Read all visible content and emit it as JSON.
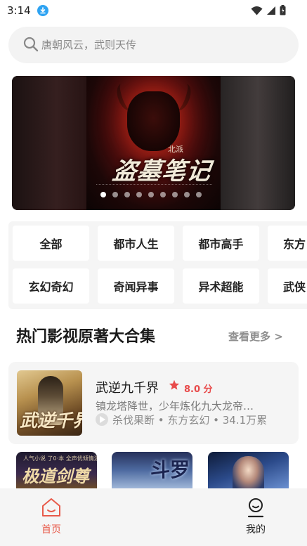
{
  "status_bar": {
    "time": "3:14",
    "icons": [
      "download-icon",
      "wifi-icon",
      "signal-icon",
      "battery-icon"
    ]
  },
  "search": {
    "placeholder": "唐朝风云，武则天传"
  },
  "banner": {
    "title": "盗墓笔记",
    "author_label": "北派",
    "page_count": 9,
    "active_index": 0
  },
  "categories": {
    "row1": [
      "全部",
      "都市人生",
      "都市高手",
      "东方"
    ],
    "row2": [
      "玄幻奇幻",
      "奇闻异事",
      "异术超能",
      "武侠"
    ]
  },
  "section": {
    "title": "热门影视原著大合集",
    "more_label": "查看更多 >"
  },
  "featured": {
    "cover_text": "武逆千界",
    "title": "武逆九千界",
    "score": "8.0 分",
    "description": "镇龙塔降世，少年炼化九大龙帝…",
    "meta": "杀伐果断 • 东方玄幻 • 34.1万累"
  },
  "thumbnails": [
    {
      "title": "极道剑尊",
      "caption": "人气小说 了0·本 全声优倾情演绎"
    },
    {
      "title": "斗罗"
    },
    {
      "title": ""
    }
  ],
  "bottom_nav": {
    "home_label": "首页",
    "mine_label": "我的"
  },
  "colors": {
    "accent": "#e85a4a",
    "star": "#e84a4a",
    "download_badge": "#2ea3f2"
  }
}
